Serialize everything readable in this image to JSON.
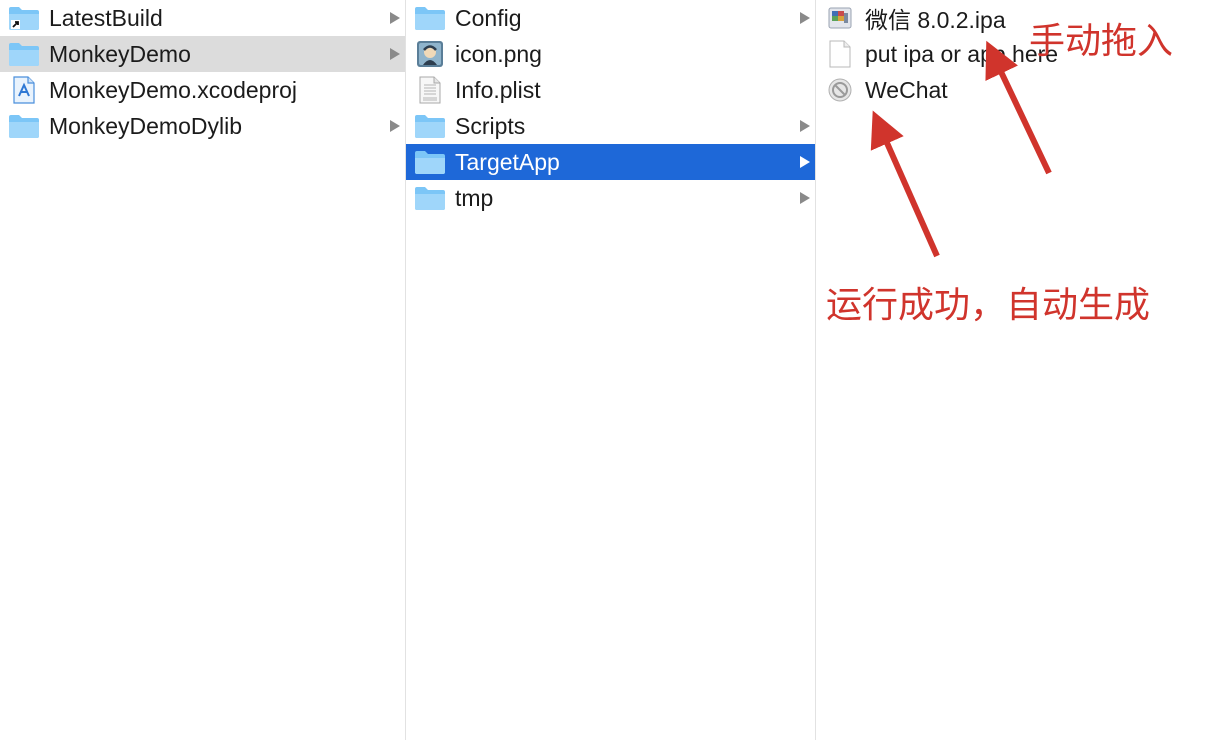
{
  "columns": [
    {
      "items": [
        {
          "label": "LatestBuild",
          "icon": "folder-alias-icon",
          "has_children": true,
          "selected": ""
        },
        {
          "label": "MonkeyDemo",
          "icon": "folder-icon",
          "has_children": true,
          "selected": "gray"
        },
        {
          "label": "MonkeyDemo.xcodeproj",
          "icon": "xcodeproj-icon",
          "has_children": false,
          "selected": ""
        },
        {
          "label": "MonkeyDemoDylib",
          "icon": "folder-icon",
          "has_children": true,
          "selected": ""
        }
      ]
    },
    {
      "items": [
        {
          "label": "Config",
          "icon": "folder-icon",
          "has_children": true,
          "selected": ""
        },
        {
          "label": "icon.png",
          "icon": "image-file-icon",
          "has_children": false,
          "selected": ""
        },
        {
          "label": "Info.plist",
          "icon": "plist-file-icon",
          "has_children": false,
          "selected": ""
        },
        {
          "label": "Scripts",
          "icon": "folder-icon",
          "has_children": true,
          "selected": ""
        },
        {
          "label": "TargetApp",
          "icon": "folder-icon",
          "has_children": true,
          "selected": "blue"
        },
        {
          "label": "tmp",
          "icon": "folder-icon",
          "has_children": true,
          "selected": ""
        }
      ]
    },
    {
      "items": [
        {
          "label": "微信 8.0.2.ipa",
          "icon": "ipa-archive-icon",
          "has_children": false,
          "selected": ""
        },
        {
          "label": "put ipa or app here",
          "icon": "blank-file-icon",
          "has_children": false,
          "selected": ""
        },
        {
          "label": "WeChat",
          "icon": "prohibited-app-icon",
          "has_children": false,
          "selected": ""
        }
      ]
    }
  ],
  "annotations": {
    "manual_drag": "手动拖入",
    "auto_generated": "运行成功，自动生成",
    "color": "#d0342c"
  },
  "colors": {
    "selection_blue": "#1e68d8",
    "selection_gray": "#dcdcdc",
    "folder_blue": "#7cc6f7"
  }
}
